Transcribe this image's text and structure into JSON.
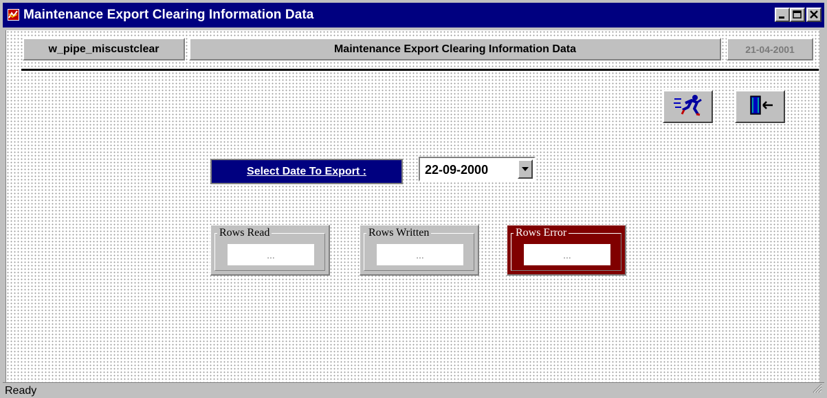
{
  "window": {
    "title": "Maintenance Export Clearing Information Data"
  },
  "header": {
    "window_name": "w_pipe_miscustclear",
    "title": "Maintenance Export Clearing Information Data",
    "date": "21-04-2001"
  },
  "toolbar": {
    "run_icon": "running-man-icon",
    "exit_icon": "exit-door-icon"
  },
  "form": {
    "select_date_label": "Select Date To Export :",
    "date_value": "22-09-2000"
  },
  "counters": [
    {
      "label": "Rows Read",
      "value": "..."
    },
    {
      "label": "Rows Written",
      "value": "..."
    },
    {
      "label": "Rows Error",
      "value": "..."
    }
  ],
  "statusbar": {
    "text": "Ready"
  },
  "colors": {
    "titlebar": "#000080",
    "select_label_bg": "#000080",
    "error_group_bg": "#800000",
    "face": "#c0c0c0"
  }
}
